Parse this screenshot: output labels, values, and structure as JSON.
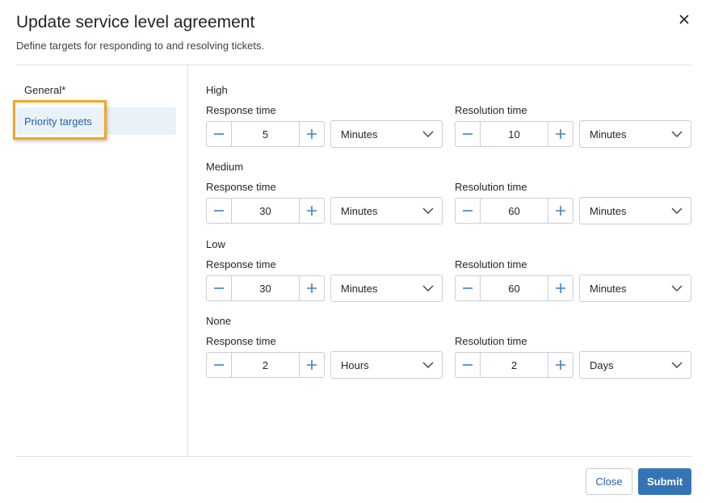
{
  "dialog": {
    "title": "Update service level agreement",
    "subtitle": "Define targets for responding to and resolving tickets."
  },
  "nav": {
    "general": "General*",
    "priority_targets": "Priority targets"
  },
  "labels": {
    "response_time": "Response time",
    "resolution_time": "Resolution time"
  },
  "priorities": [
    {
      "name": "High",
      "response": {
        "value": "5",
        "unit": "Minutes"
      },
      "resolution": {
        "value": "10",
        "unit": "Minutes"
      }
    },
    {
      "name": "Medium",
      "response": {
        "value": "30",
        "unit": "Minutes"
      },
      "resolution": {
        "value": "60",
        "unit": "Minutes"
      }
    },
    {
      "name": "Low",
      "response": {
        "value": "30",
        "unit": "Minutes"
      },
      "resolution": {
        "value": "60",
        "unit": "Minutes"
      }
    },
    {
      "name": "None",
      "response": {
        "value": "2",
        "unit": "Hours"
      },
      "resolution": {
        "value": "2",
        "unit": "Days"
      }
    }
  ],
  "footer": {
    "close_label": "Close",
    "submit_label": "Submit"
  },
  "colors": {
    "accent": "#3474b5",
    "nav_selected_bg": "#e9f1f9",
    "highlight": "#f5a623",
    "stepper_icon": "#3b82c4"
  }
}
